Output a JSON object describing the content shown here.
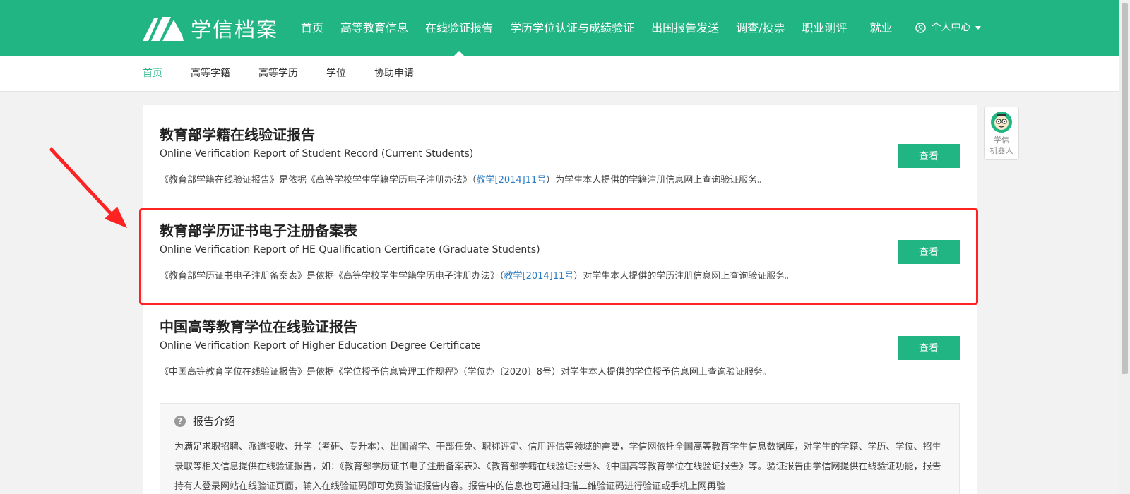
{
  "header": {
    "logo_text": "学信档案",
    "nav": [
      {
        "label": "首页"
      },
      {
        "label": "高等教育信息"
      },
      {
        "label": "在线验证报告"
      },
      {
        "label": "学历学位认证与成绩验证"
      },
      {
        "label": "出国报告发送"
      },
      {
        "label": "调查/投票"
      },
      {
        "label": "职业测评"
      },
      {
        "label": "就业"
      }
    ],
    "user_center": "个人中心"
  },
  "subnav": {
    "items": [
      {
        "label": "首页"
      },
      {
        "label": "高等学籍"
      },
      {
        "label": "高等学历"
      },
      {
        "label": "学位"
      },
      {
        "label": "协助申请"
      }
    ]
  },
  "reports": [
    {
      "title": "教育部学籍在线验证报告",
      "subtitle": "Online Verification Report of Student Record (Current Students)",
      "desc_before": "《教育部学籍在线验证报告》是依据《高等学校学生学籍学历电子注册办法》（",
      "desc_link": "教学[2014]11号",
      "desc_after": "）为学生本人提供的学籍注册信息网上查询验证服务。",
      "button": "查看"
    },
    {
      "title": "教育部学历证书电子注册备案表",
      "subtitle": "Online Verification Report of HE Qualification Certificate (Graduate Students)",
      "desc_before": "《教育部学历证书电子注册备案表》是依据《高等学校学生学籍学历电子注册办法》（",
      "desc_link": "教学[2014]11号",
      "desc_after": "）对学生本人提供的学历注册信息网上查询验证服务。",
      "button": "查看"
    },
    {
      "title": "中国高等教育学位在线验证报告",
      "subtitle": "Online Verification Report of Higher Education Degree Certificate",
      "desc_before": "《中国高等教育学位在线验证报告》是依据《学位授予信息管理工作规程》（学位办〔2020〕8号）对学生本人提供的学位授予信息网上查询验证服务。",
      "desc_link": "",
      "desc_after": "",
      "button": "查看"
    }
  ],
  "intro": {
    "title": "报告介绍",
    "body": "为满足求职招聘、派遣接收、升学（考研、专升本）、出国留学、干部任免、职称评定、信用评估等领域的需要，学信网依托全国高等教育学生信息数据库，对学生的学籍、学历、学位、招生录取等相关信息提供在线验证报告，如：《教育部学历证书电子注册备案表》、《教育部学籍在线验证报告》、《中国高等教育学位在线验证报告》等。验证报告由学信网提供在线验证功能，报告持有人登录网站在线验证页面，输入在线验证码即可免费验证报告内容。报告中的信息也可通过扫描二维验证码进行验证或手机上网再验"
  },
  "robot": {
    "label_line1": "学信",
    "label_line2": "机器人"
  },
  "colors": {
    "brand_green": "#21b584",
    "link_blue": "#2a7bc4",
    "highlight_red": "#ff2222"
  }
}
